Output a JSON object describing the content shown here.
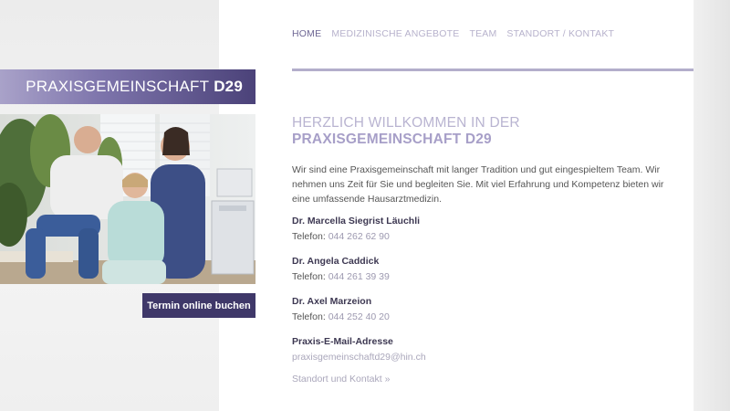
{
  "brand": {
    "name_regular": "PRAXISGEMEINSCHAFT",
    "name_bold": "D29"
  },
  "nav": {
    "items": [
      {
        "label": "HOME",
        "active": true
      },
      {
        "label": "MEDIZINISCHE ANGEBOTE",
        "active": false
      },
      {
        "label": "TEAM",
        "active": false
      },
      {
        "label": "STANDORT / KONTAKT",
        "active": false
      }
    ]
  },
  "hero": {
    "photo_alt": "team-photo"
  },
  "cta": {
    "book_label": "Termin online buchen"
  },
  "main": {
    "heading_line1": "HERZLICH WILLKOMMEN IN DER",
    "heading_line2": "PRAXISGEMEINSCHAFT D29",
    "intro": "Wir sind eine Praxisgemeinschaft mit langer Tradition und gut eingespieltem Team. Wir nehmen uns Zeit für Sie und begleiten Sie. Mit viel Erfahrung und Kompetenz bieten wir eine umfassende Hausarztmedizin.",
    "doctors": [
      {
        "name": "Dr. Marcella Siegrist Läuchli",
        "phone_label": "Telefon:",
        "phone": "044 262 62 90"
      },
      {
        "name": "Dr. Angela Caddick",
        "phone_label": "Telefon:",
        "phone": "044 261 39 39"
      },
      {
        "name": "Dr. Axel Marzeion",
        "phone_label": "Telefon:",
        "phone": "044 252 40 20"
      }
    ],
    "email_heading": "Praxis-E-Mail-Adresse",
    "email": "praxisgemeinschaftd29@hin.ch",
    "location_link": "Standort und Kontakt »"
  },
  "colors": {
    "accent": "#3f3869",
    "banner_start": "#a9a2c9",
    "banner_end": "#4b4279",
    "nav_rule": "#b3aecb"
  }
}
